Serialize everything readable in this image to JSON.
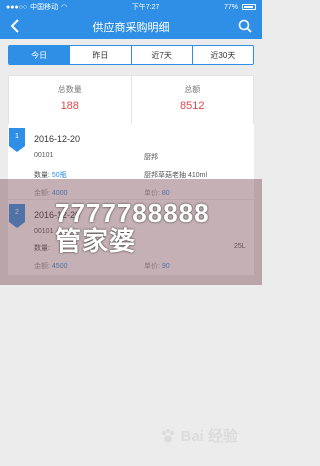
{
  "status_bar": {
    "carrier": "中国移动",
    "time": "下午7:27",
    "battery": "77%"
  },
  "nav": {
    "title": "供应商采购明细"
  },
  "tabs": [
    {
      "label": "今日",
      "active": true
    },
    {
      "label": "昨日",
      "active": false
    },
    {
      "label": "近7天",
      "active": false
    },
    {
      "label": "近30天",
      "active": false
    }
  ],
  "summary": {
    "qty_label": "总数量",
    "qty_value": "188",
    "amount_label": "总额",
    "amount_value": "8512"
  },
  "records": [
    {
      "index": "1",
      "date": "2016-12-20",
      "code": "00101",
      "store": "厨邦",
      "qty_label": "数量:",
      "qty": "50瓶",
      "product": "厨邦草菇老抽 410ml",
      "amount_label": "金额:",
      "amount": "4000",
      "price_label": "单价:",
      "price": "80"
    },
    {
      "index": "2",
      "date": "2016-12-20",
      "code": "00101",
      "store": "",
      "qty_label": "数量:",
      "qty": "",
      "product": "25L",
      "amount_label": "金额:",
      "amount": "4500",
      "price_label": "单价:",
      "price": "90"
    }
  ],
  "watermark": {
    "text": "7777788888管家婆",
    "brand": "Bai 经验"
  },
  "colors": {
    "primary": "#2f8fe6",
    "accent": "#e04949"
  }
}
